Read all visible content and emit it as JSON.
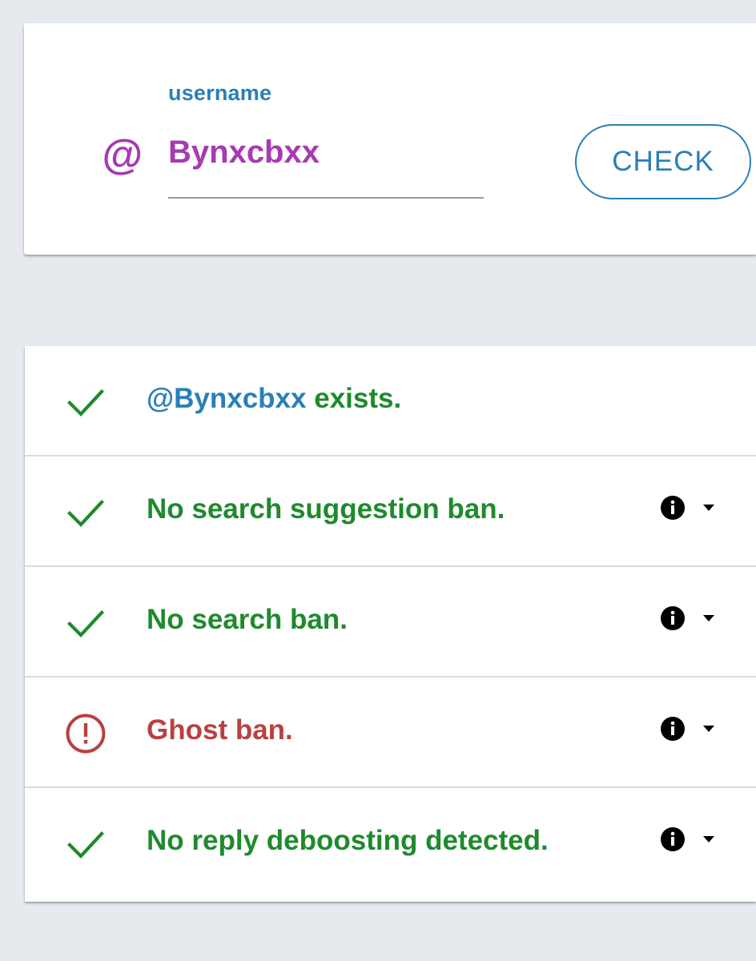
{
  "search": {
    "label": "username",
    "value": "Bynxcbxx",
    "at_symbol": "@",
    "check_button_label": "CHECK"
  },
  "results": [
    {
      "status": "ok",
      "icon": "check-icon",
      "handle": "@Bynxcbxx",
      "text": "exists.",
      "has_info": false
    },
    {
      "status": "ok",
      "icon": "check-icon",
      "text": "No search suggestion ban.",
      "has_info": true
    },
    {
      "status": "ok",
      "icon": "check-icon",
      "text": "No search ban.",
      "has_info": true
    },
    {
      "status": "alert",
      "icon": "alert-circle-icon",
      "text": "Ghost ban.",
      "has_info": true
    },
    {
      "status": "ok",
      "icon": "check-icon",
      "text": "No reply deboosting detected.",
      "has_info": true
    }
  ],
  "colors": {
    "background": "#e6eaee",
    "accent_blue": "#2a7fb8",
    "username_purple": "#a73ab2",
    "ok_green": "#1e8a2c",
    "alert_red": "#b94141"
  }
}
